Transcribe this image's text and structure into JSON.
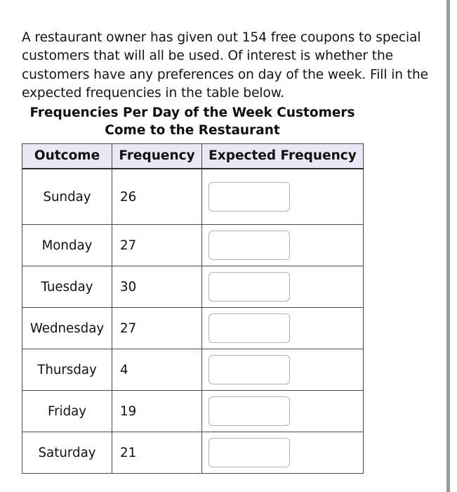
{
  "prompt": {
    "text": "A restaurant owner has given out 154 free coupons to special customers that will all be used. Of interest is whether the customers have any preferences on day of the week. Fill in the expected frequencies in the table below."
  },
  "table": {
    "caption": "Frequencies Per Day of the Week Customers Come to the Restaurant",
    "columns": [
      "Outcome",
      "Frequency",
      "Expected Frequency"
    ],
    "rows": [
      {
        "outcome": "Sunday",
        "frequency": "26",
        "expected": ""
      },
      {
        "outcome": "Monday",
        "frequency": "27",
        "expected": ""
      },
      {
        "outcome": "Tuesday",
        "frequency": "30",
        "expected": ""
      },
      {
        "outcome": "Wednesday",
        "frequency": "27",
        "expected": ""
      },
      {
        "outcome": "Thursday",
        "frequency": "4",
        "expected": ""
      },
      {
        "outcome": "Friday",
        "frequency": "19",
        "expected": ""
      },
      {
        "outcome": "Saturday",
        "frequency": "21",
        "expected": ""
      }
    ]
  },
  "colors": {
    "header_background": "#e9e9f5",
    "table_border": "#4a4a4a",
    "input_border": "#b2b2b2",
    "scrollbar_thumb": "#9a9a9a",
    "text": "#111111"
  }
}
